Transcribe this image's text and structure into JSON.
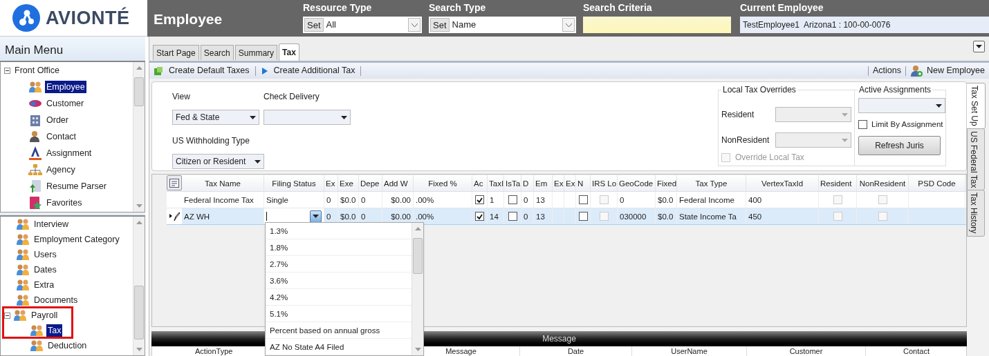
{
  "logo": {
    "name": "AVIONTÉ"
  },
  "header": {
    "title": "Employee",
    "resource_type": {
      "label": "Resource Type",
      "set": "Set",
      "value": "All"
    },
    "search_type": {
      "label": "Search Type",
      "set": "Set",
      "value": "Name"
    },
    "search_criteria": {
      "label": "Search Criteria"
    },
    "current_employee": {
      "label": "Current Employee",
      "value": "TestEmployee1  Arizona1 : 100-00-0076"
    }
  },
  "main_menu": {
    "title": "Main Menu",
    "upper_tree": [
      {
        "label": "Front Office",
        "expanded": true,
        "selected": false,
        "children": [
          {
            "label": "Employee",
            "selected": true
          },
          {
            "label": "Customer",
            "selected": false
          },
          {
            "label": "Order",
            "selected": false
          },
          {
            "label": "Contact",
            "selected": false
          },
          {
            "label": "Assignment",
            "selected": false
          },
          {
            "label": "Agency",
            "selected": false
          },
          {
            "label": "Resume Parser",
            "selected": false
          },
          {
            "label": "Favorites",
            "selected": false
          }
        ]
      }
    ],
    "lower_tree": [
      {
        "label": "Interview",
        "selected": false
      },
      {
        "label": "Employment Category",
        "selected": false
      },
      {
        "label": "Users",
        "selected": false
      },
      {
        "label": "Dates",
        "selected": false
      },
      {
        "label": "Extra",
        "selected": false
      },
      {
        "label": "Documents",
        "selected": false
      },
      {
        "label": "Payroll",
        "expanded": true,
        "selected": false,
        "children": [
          {
            "label": "Tax",
            "selected": true
          },
          {
            "label": "Deduction",
            "selected": false
          }
        ]
      }
    ]
  },
  "tabs": [
    {
      "label": "Start Page",
      "selected": false
    },
    {
      "label": "Search",
      "selected": false
    },
    {
      "label": "Summary",
      "selected": false
    },
    {
      "label": "Tax",
      "selected": true
    }
  ],
  "toolbar": {
    "left": [
      "Create Default Taxes",
      "Create Additional Tax"
    ],
    "right": [
      "Actions",
      "New Employee"
    ]
  },
  "form": {
    "view": {
      "label": "View",
      "value": "Fed & State"
    },
    "check_delivery": {
      "label": "Check Delivery"
    },
    "us_withholding_type": {
      "label": "US Withholding Type",
      "value": "Citizen or Resident"
    },
    "local_tax_overrides": {
      "title": "Local Tax Overrides",
      "resident": "Resident",
      "nonresident": "NonResident",
      "override": {
        "label": "Override Local Tax",
        "checked": false,
        "disabled": true
      }
    },
    "active_assignments": {
      "title": "Active Assignments",
      "limit": {
        "label": "Limit By Assignment",
        "checked": false
      },
      "refresh": "Refresh Juris"
    }
  },
  "side_tabs": [
    {
      "label": "Tax Set Up",
      "selected": true
    },
    {
      "label": "US Federal Tax",
      "selected": false
    },
    {
      "label": "Tax History",
      "selected": false
    }
  ],
  "grid": {
    "columns": [
      "Tax Name",
      "Filing Status",
      "Ex",
      "Exe",
      "Depe",
      "Add W",
      "Fixed %",
      "Ac",
      "TaxI",
      "IsTa",
      "D",
      "Em",
      "Ex",
      "Ex",
      "N",
      "IRS Lo",
      "GeoCode",
      "Fixed",
      "Tax Type",
      "VertexTaxId",
      "Resident",
      "NonResident",
      "PSD Code"
    ],
    "rows": [
      {
        "selected": false,
        "editing": false,
        "cells": [
          {
            "kind": "text",
            "text": "Federal Income Tax"
          },
          {
            "kind": "text",
            "text": "Single"
          },
          {
            "kind": "text",
            "text": "0"
          },
          {
            "kind": "text",
            "text": "$0.0"
          },
          {
            "kind": "text",
            "text": "0"
          },
          {
            "kind": "text",
            "text": "$0.00"
          },
          {
            "kind": "text",
            "text": ".00%"
          },
          {
            "kind": "check",
            "checked": true,
            "disabled": false
          },
          {
            "kind": "text",
            "text": "1"
          },
          {
            "kind": "check",
            "checked": false,
            "disabled": false
          },
          {
            "kind": "text",
            "text": "0"
          },
          {
            "kind": "text",
            "text": "13"
          },
          {
            "kind": "empty"
          },
          {
            "kind": "empty"
          },
          {
            "kind": "check",
            "checked": false,
            "disabled": false
          },
          {
            "kind": "check",
            "checked": false,
            "disabled": true
          },
          {
            "kind": "text",
            "text": "0"
          },
          {
            "kind": "text",
            "text": "$0.0"
          },
          {
            "kind": "text",
            "text": "Federal Income"
          },
          {
            "kind": "text",
            "text": "400"
          },
          {
            "kind": "check",
            "checked": false,
            "disabled": true
          },
          {
            "kind": "check",
            "checked": false,
            "disabled": true
          },
          {
            "kind": "empty"
          }
        ]
      },
      {
        "selected": true,
        "editing": true,
        "cells": [
          {
            "kind": "text",
            "text": "AZ WH"
          },
          {
            "kind": "editor"
          },
          {
            "kind": "text",
            "text": "0"
          },
          {
            "kind": "text",
            "text": "$0.0"
          },
          {
            "kind": "text",
            "text": "0"
          },
          {
            "kind": "text",
            "text": "$0.00"
          },
          {
            "kind": "text",
            "text": ".00%"
          },
          {
            "kind": "check",
            "checked": true,
            "disabled": false
          },
          {
            "kind": "text",
            "text": "14"
          },
          {
            "kind": "check",
            "checked": false,
            "disabled": false
          },
          {
            "kind": "text",
            "text": "0"
          },
          {
            "kind": "text",
            "text": "13"
          },
          {
            "kind": "empty"
          },
          {
            "kind": "empty"
          },
          {
            "kind": "check",
            "checked": false,
            "disabled": false
          },
          {
            "kind": "check",
            "checked": false,
            "disabled": true
          },
          {
            "kind": "text",
            "text": "030000"
          },
          {
            "kind": "text",
            "text": "$0.0"
          },
          {
            "kind": "text",
            "text": "State Income Ta"
          },
          {
            "kind": "text",
            "text": "450"
          },
          {
            "kind": "check",
            "checked": false,
            "disabled": true
          },
          {
            "kind": "check",
            "checked": false,
            "disabled": true
          },
          {
            "kind": "empty"
          }
        ]
      }
    ]
  },
  "filing_dropdown": [
    "1.3%",
    "1.8%",
    "2.7%",
    "3.6%",
    "4.2%",
    "5.1%",
    "Percent based on annual gross",
    "AZ No State A4 Filed"
  ],
  "message_panel": {
    "title": "Message",
    "columns": [
      "ActionType",
      "Message",
      "Date",
      "UserName",
      "Customer",
      "Contact"
    ]
  }
}
